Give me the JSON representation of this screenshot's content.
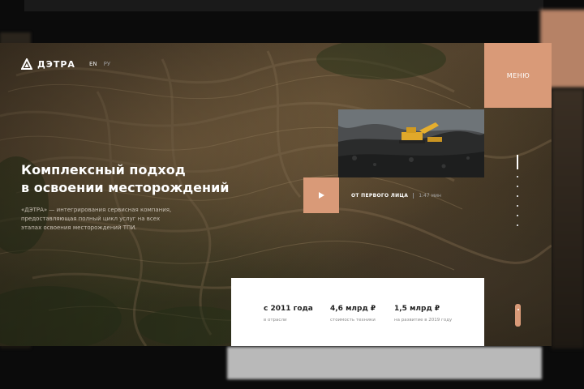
{
  "brand": {
    "name": "ДЭТРА"
  },
  "languages": {
    "en": "EN",
    "ru": "РУ"
  },
  "menu": {
    "label": "МЕНЮ"
  },
  "hero": {
    "title_line1": "Комплексный подход",
    "title_line2": "в освоении месторождений",
    "description": "«ДЭТРА» — интегрирования сервисная компания, предоставляющая полный цикл услуг на всех этапах освоения месторождений ТПИ."
  },
  "video": {
    "title": "ОТ ПЕРВОГО ЛИЦА",
    "duration": "1:47 мин"
  },
  "stats": [
    {
      "value": "с 2011 года",
      "label": "в отрасли"
    },
    {
      "value": "4,6 млрд ₽",
      "label": "стоимость техники"
    },
    {
      "value": "1,5 млрд ₽",
      "label": "на развитие в 2019 году"
    }
  ],
  "colors": {
    "accent": "#d99a78",
    "background": "#0b0b0b",
    "panel": "#ffffff"
  }
}
